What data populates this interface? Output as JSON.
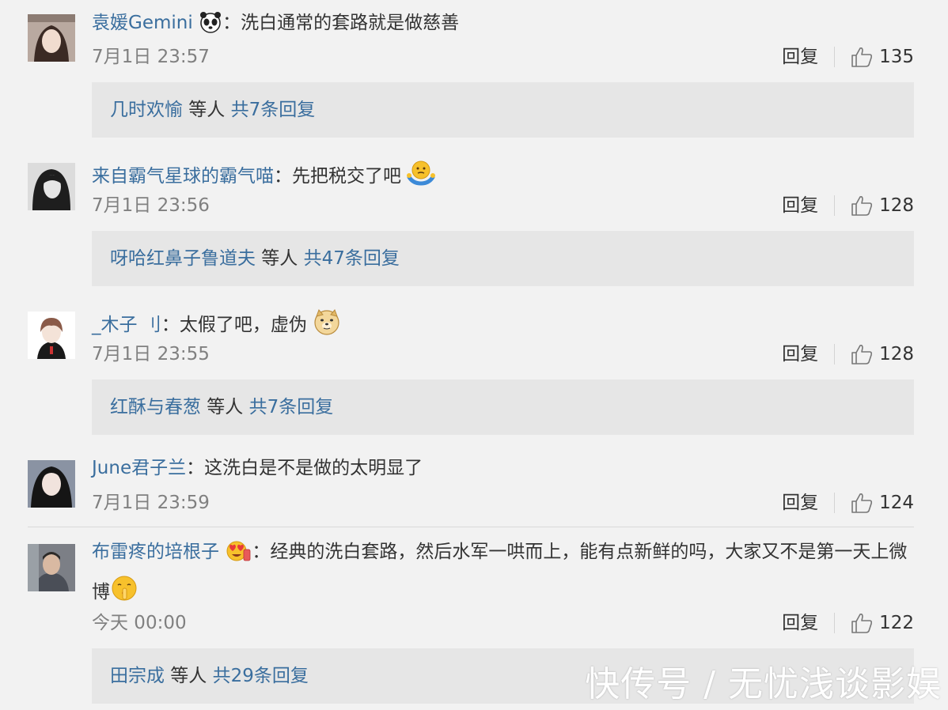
{
  "comments": [
    {
      "username": "袁媛Gemini",
      "username_emoji": "panda-emoji",
      "separator": "：",
      "text": "洗白通常的套路就是做慈善",
      "text_emoji": "",
      "time": "7月1日 23:57",
      "reply_label": "回复",
      "likes": "135",
      "replies": {
        "names": "几时欢愉",
        "middle": " 等人 ",
        "total": "共7条回复"
      }
    },
    {
      "username": "来自霸气星球的霸气喵",
      "username_emoji": "",
      "separator": "：",
      "text": "先把税交了吧",
      "text_emoji": "shrug-emoji",
      "time": "7月1日 23:56",
      "reply_label": "回复",
      "likes": "128",
      "replies": {
        "names": "呀哈红鼻子鲁道夫",
        "middle": " 等人 ",
        "total": "共47条回复"
      }
    },
    {
      "username": "_木子 刂",
      "username_emoji": "",
      "separator": "：",
      "text": "太假了吧，虚伪",
      "text_emoji": "doge-emoji",
      "time": "7月1日 23:55",
      "reply_label": "回复",
      "likes": "128",
      "replies": {
        "names": "红酥与春葱",
        "middle": " 等人 ",
        "total": "共7条回复"
      }
    },
    {
      "username": "June君子兰",
      "username_emoji": "",
      "separator": "：",
      "text": "这洗白是不是做的太明显了",
      "text_emoji": "",
      "time": "7月1日 23:59",
      "reply_label": "回复",
      "likes": "124"
    },
    {
      "username": "布雷疼的培根子",
      "username_emoji": "heart-eyes-emoji",
      "separator": "：",
      "text": "经典的洗白套路，然后水军一哄而上，能有点新鲜的吗，大家又不是第一天上微博",
      "text_emoji": "shush-emoji",
      "time": "今天 00:00",
      "reply_label": "回复",
      "likes": "122",
      "replies": {
        "names": "田宗成",
        "middle": " 等人 ",
        "total": "共29条回复"
      }
    }
  ],
  "watermark": "快传号 / 无忧浅谈影娱",
  "colors": {
    "page_bg": "#f2f2f2",
    "link": "#3a6e9e",
    "text": "#333333",
    "muted": "#808080",
    "reply_box_bg": "#e6e6e6"
  }
}
